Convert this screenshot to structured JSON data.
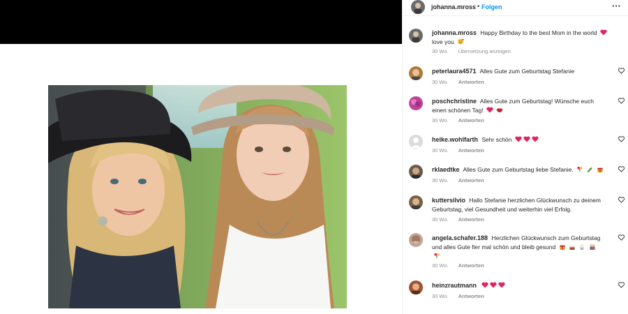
{
  "header": {
    "username": "johanna.mross",
    "separator": "•",
    "follow_label": "Folgen",
    "more_icon": "more-horizontal-icon"
  },
  "caption": {
    "username": "johanna.mross",
    "text": "Happy Birthday to the best Mom in the world",
    "text2": "love you",
    "time": "30 Wo.",
    "translate_label": "Übersetzung anzeigen"
  },
  "reply_label": "Antworten",
  "comments": [
    {
      "username": "peterlaura4571",
      "text": "Alles Gute zum Geburtstag Stefanie",
      "time": "30 Wo.",
      "emojis": [],
      "avatar_color": "#b07a3c"
    },
    {
      "username": "poschchristine",
      "text": "Alles Gute zum Geburtstag! Wünsche euch einen schönen Tag!",
      "time": "30 Wo.",
      "emojis": [
        "red-heart",
        "lips"
      ],
      "avatar_color": "#c0439a"
    },
    {
      "username": "heike.wohlfarth",
      "text": "Sehr schön",
      "time": "30 Wo.",
      "emojis": [
        "red-heart",
        "red-heart",
        "red-heart"
      ],
      "avatar_color": "#dbdbdb"
    },
    {
      "username": "rklaedtke",
      "text": "Alles Gute zum Geburtstag liebe Stefanie.",
      "time": "30 Wo.",
      "emojis": [
        "bouquet",
        "champagne",
        "gift"
      ],
      "avatar_color": "#6b5a4a"
    },
    {
      "username": "kuttersilvio",
      "text": "Hallo Stefanie herzlichen Glückwunsch zu deinem Geburtstag, viel Gesundheit und weiterhin viel Erfolg.",
      "time": "30 Wo.",
      "emojis": [],
      "avatar_color": "#7a6048"
    },
    {
      "username": "angela.schafer.188",
      "text": "Herzlichen Glückwunsch zum Geburtstag und alles Gute fier mal schön und bleib gesund",
      "time": "30 Wo.",
      "emojis": [
        "gift",
        "cake",
        "cupcake",
        "people",
        "bouquet"
      ],
      "avatar_color": "#c4a596"
    },
    {
      "username": "heinzrautmann",
      "text": "",
      "time": "30 Wo.",
      "emojis": [
        "red-heart",
        "red-heart",
        "red-heart"
      ],
      "avatar_color": "#a0522d"
    }
  ],
  "colors": {
    "accent": "#0095f6",
    "meta": "#8e8e8e",
    "text": "#262626",
    "heart": "#ed4956"
  }
}
